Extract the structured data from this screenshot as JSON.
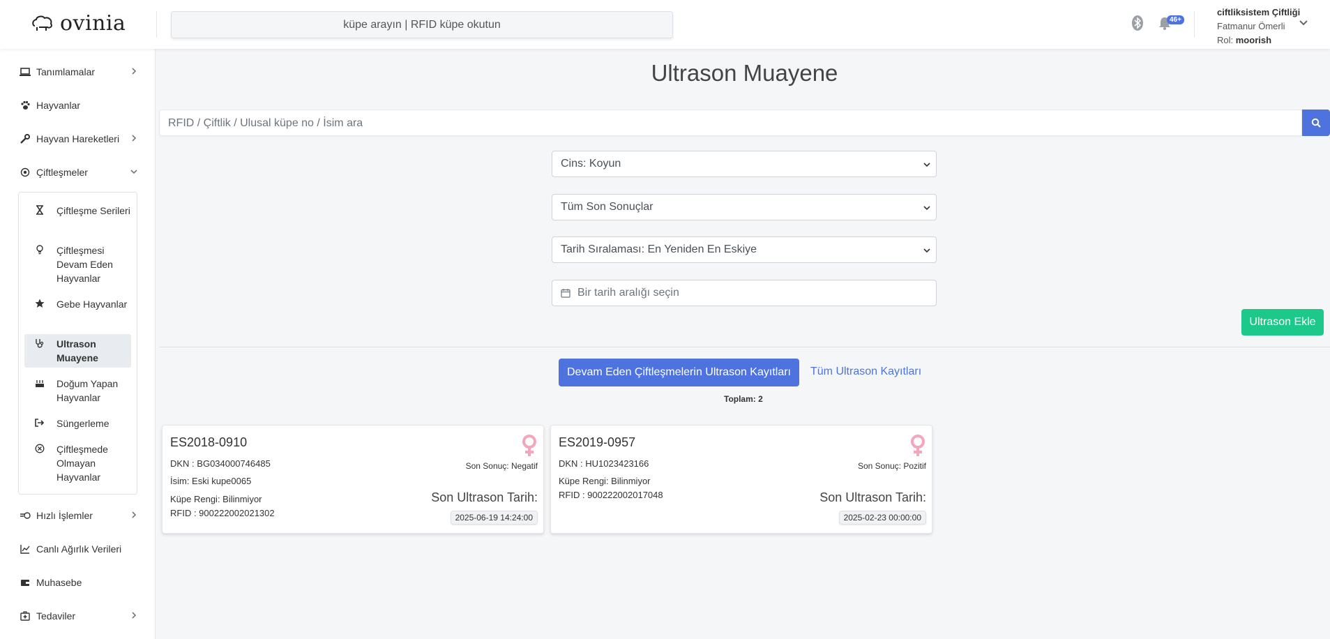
{
  "header": {
    "brand": "ovinia",
    "search_placeholder": "küpe arayın | RFID küpe okutun",
    "notification_badge": "46+",
    "user": {
      "farm": "ciftliksistem Çiftliği",
      "name": "Fatmanur Ömerli",
      "role_label": "Rol:",
      "role": "moorish"
    }
  },
  "sidebar": {
    "items": [
      {
        "label": "Tanımlamalar",
        "icon": "laptop-icon"
      },
      {
        "label": "Hayvanlar",
        "icon": "paw-icon"
      },
      {
        "label": "Hayvan Hareketleri",
        "icon": "wrench-icon"
      },
      {
        "label": "Çiftleşmeler",
        "icon": "dot-circle-icon"
      },
      {
        "label": "Hızlı İşlemler",
        "icon": "bolt-icon"
      },
      {
        "label": "Canlı Ağırlık Verileri",
        "icon": "chart-line-icon"
      },
      {
        "label": "Muhasebe",
        "icon": "wallet-icon"
      },
      {
        "label": "Tedaviler",
        "icon": "medkit-icon"
      }
    ],
    "submenu": [
      {
        "label": "Çiftleşme Serileri",
        "icon": "hourglass-icon"
      },
      {
        "label": "Çiftleşmesi Devam Eden Hayvanlar",
        "icon": "lightbulb-icon"
      },
      {
        "label": "Gebe Hayvanlar",
        "icon": "star-icon"
      },
      {
        "label": "Ultrason Muayene",
        "icon": "stethoscope-icon"
      },
      {
        "label": "Doğum Yapan Hayvanlar",
        "icon": "cake-icon"
      },
      {
        "label": "Süngerleme",
        "icon": "sign-out-icon"
      },
      {
        "label": "Çiftleşmede Olmayan Hayvanlar",
        "icon": "times-circle-icon"
      }
    ]
  },
  "main": {
    "title": "Ultrason Muayene",
    "search_placeholder": "RFID / Çiftlik / Ulusal küpe no / İsim ara",
    "filters": {
      "breed": "Cins: Koyun",
      "result": "Tüm Son Sonuçlar",
      "sort": "Tarih Sıralaması: En Yeniden En Eskiye",
      "date_placeholder": "Bir tarih aralığı seçin"
    },
    "add_button": "Ultrason Ekle",
    "tabs": {
      "active": "Devam Eden Çiftleşmelerin Ultrason Kayıtları",
      "other": "Tüm Ultrason Kayıtları"
    },
    "total": "Toplam: 2",
    "cards": [
      {
        "tag": "ES2018-0910",
        "dkn": "DKN : BG034000746485",
        "name": "İsim: Eski kupe0065",
        "color": "Küpe Rengi: Bilinmiyor",
        "rfid": "RFID : 900222002021302",
        "result": "Son Sonuç: Negatif",
        "ultra_label": "Son Ultrason Tarih:",
        "ultra_date": "2025-06-19 14:24:00"
      },
      {
        "tag": "ES2019-0957",
        "dkn": "DKN : HU1023423166",
        "color": "Küpe Rengi: Bilinmiyor",
        "rfid": "RFID : 900222002017048",
        "result": "Son Sonuç: Pozitif",
        "ultra_label": "Son Ultrason Tarih:",
        "ultra_date": "2025-02-23 00:00:00"
      }
    ]
  },
  "colors": {
    "primary": "#4e73df",
    "success": "#1cc88a",
    "female": "#f4a6bd"
  }
}
